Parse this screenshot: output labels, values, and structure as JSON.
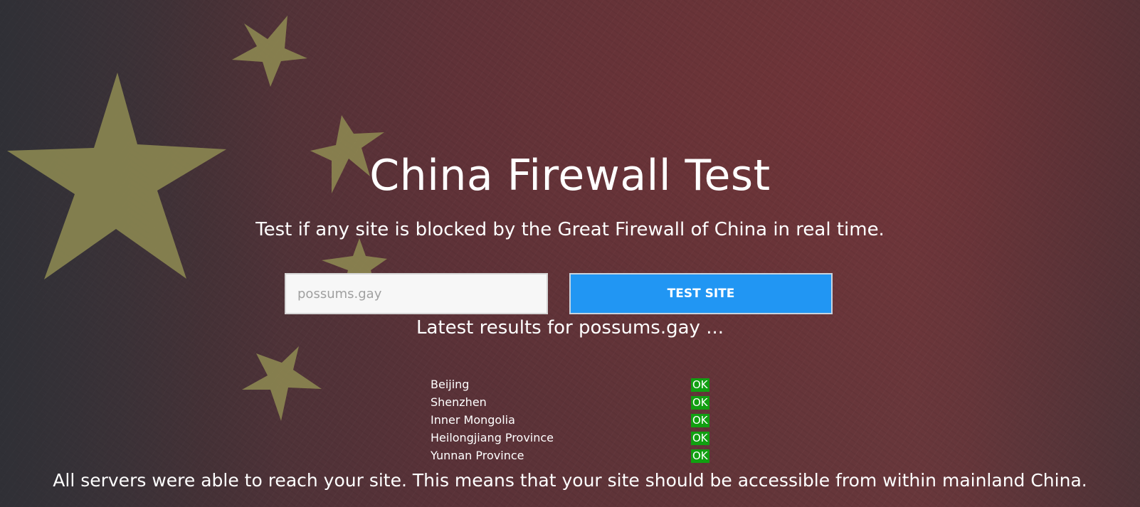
{
  "page": {
    "title": "China Firewall Test",
    "subtitle": "Test if any site is blocked by the Great Firewall of China in real time."
  },
  "form": {
    "input_placeholder": "possums.gay",
    "input_value": "",
    "button_label": "TEST SITE",
    "button_color": "#2196f3"
  },
  "results": {
    "heading": "Latest results for possums.gay ...",
    "ok_color": "#119f11",
    "items": [
      {
        "location": "Beijing",
        "status": "OK"
      },
      {
        "location": "Shenzhen",
        "status": "OK"
      },
      {
        "location": "Inner Mongolia",
        "status": "OK"
      },
      {
        "location": "Heilongjiang Province",
        "status": "OK"
      },
      {
        "location": "Yunnan Province",
        "status": "OK"
      }
    ],
    "summary": "All servers were able to reach your site. This means that your site should be accessible from within mainland China."
  },
  "background": {
    "description_icon": "china-flag-background",
    "flag_red": "#633539",
    "star_color": "#8f8c52"
  }
}
